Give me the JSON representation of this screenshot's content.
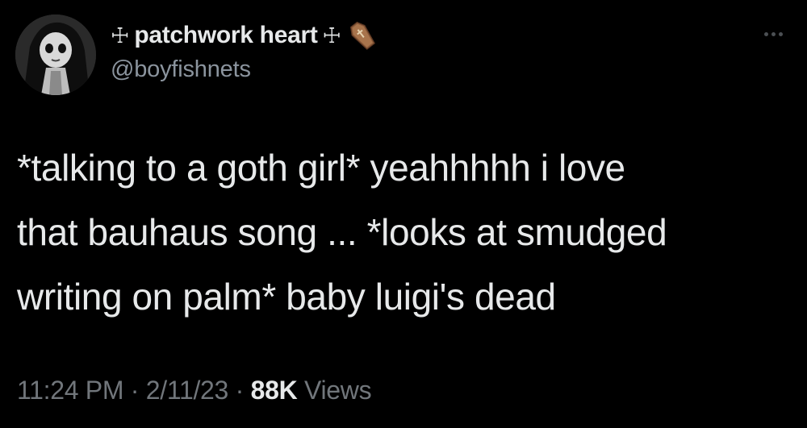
{
  "author": {
    "display_name": "patchwork heart",
    "name_prefix_glyph": "☩",
    "name_suffix_glyph": "☩",
    "suffix_icon": "coffin-icon",
    "handle": "@boyfishnets",
    "avatar_icon": "goth-doll-avatar"
  },
  "tweet": {
    "text_lines": [
      "*talking to a goth girl* yeahhhhh i love",
      "that bauhaus song ... *looks at smudged",
      "writing on palm* baby luigi's dead"
    ]
  },
  "meta": {
    "time": "11:24 PM",
    "separator": " · ",
    "date": "2/11/23",
    "views_count": "88K",
    "views_label": "Views"
  },
  "colors": {
    "background": "#000000",
    "primary_text": "#e7e9ea",
    "secondary_text": "#71767b"
  },
  "more_menu": {
    "icon": "more-dots-icon"
  }
}
